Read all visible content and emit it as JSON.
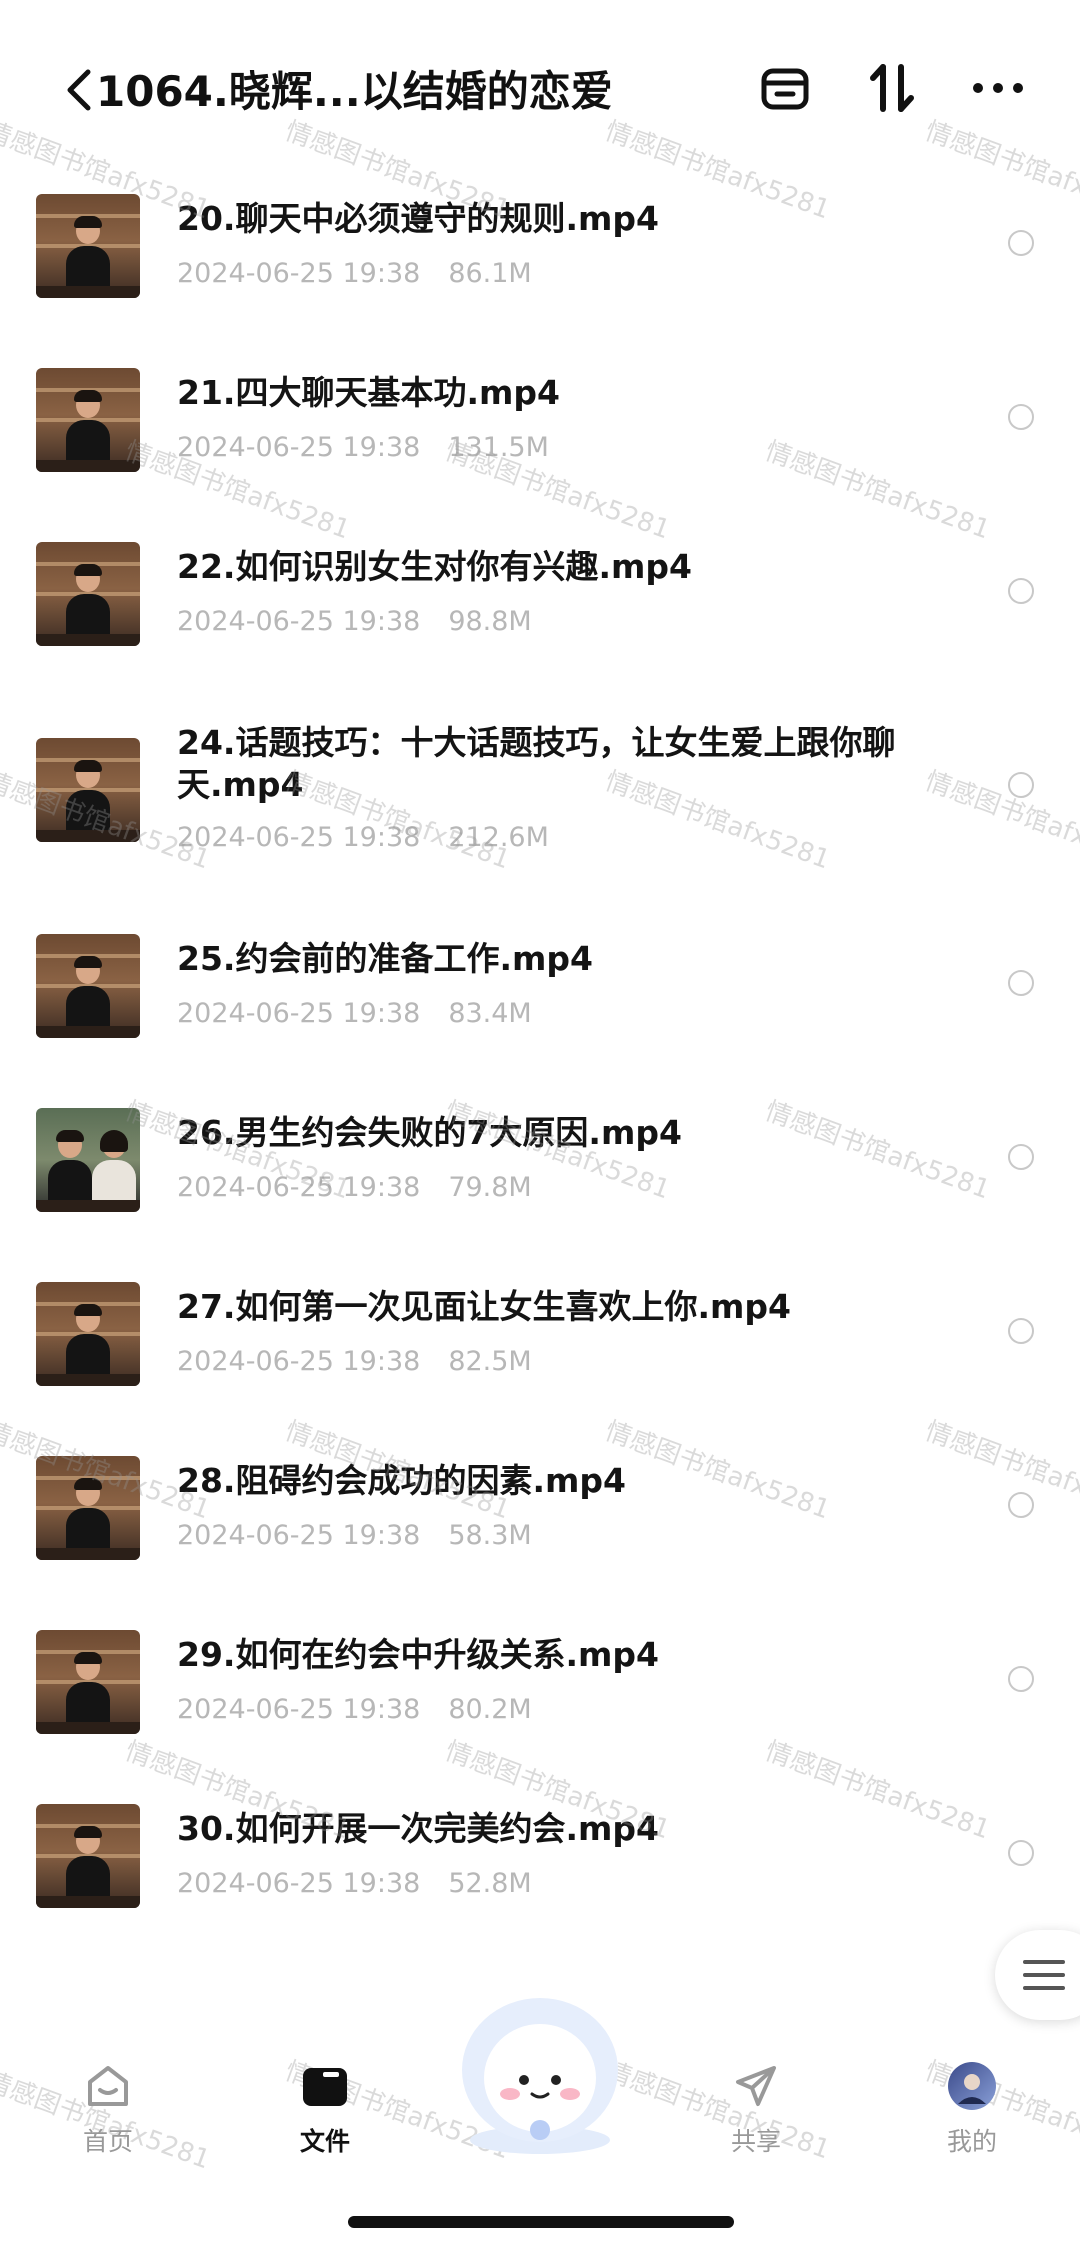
{
  "header": {
    "title": "1064.晓辉...以结婚的恋爱",
    "icons": [
      "back-icon",
      "tray-icon",
      "sort-icon",
      "more-icon"
    ]
  },
  "files": [
    {
      "name": "20.聊天中必须遵守的规则.mp4",
      "date": "2024-06-25 19:38",
      "size": "86.1M"
    },
    {
      "name": "21.四大聊天基本功.mp4",
      "date": "2024-06-25 19:38",
      "size": "131.5M"
    },
    {
      "name": "22.如何识别女生对你有兴趣.mp4",
      "date": "2024-06-25 19:38",
      "size": "98.8M"
    },
    {
      "name": "24.话题技巧：十大话题技巧，让女生爱上跟你聊天.mp4",
      "date": "2024-06-25 19:38",
      "size": "212.6M"
    },
    {
      "name": "25.约会前的准备工作.mp4",
      "date": "2024-06-25 19:38",
      "size": "83.4M"
    },
    {
      "name": "26.男生约会失败的7大原因.mp4",
      "date": "2024-06-25 19:38",
      "size": "79.8M"
    },
    {
      "name": "27.如何第一次见面让女生喜欢上你.mp4",
      "date": "2024-06-25 19:38",
      "size": "82.5M"
    },
    {
      "name": "28.阻碍约会成功的因素.mp4",
      "date": "2024-06-25 19:38",
      "size": "58.3M"
    },
    {
      "name": "29.如何在约会中升级关系.mp4",
      "date": "2024-06-25 19:38",
      "size": "80.2M"
    },
    {
      "name": "30.如何开展一次完美约会.mp4",
      "date": "2024-06-25 19:38",
      "size": "52.8M"
    }
  ],
  "watermark": "情感图书馆afx5281",
  "tabs": [
    {
      "label": "首页",
      "icon": "home-icon"
    },
    {
      "label": "文件",
      "icon": "folder-icon",
      "active": true
    },
    {
      "label": "共享",
      "icon": "send-icon"
    },
    {
      "label": "我的",
      "icon": "avatar-icon"
    }
  ],
  "colors": {
    "text": "#141414",
    "meta": "#b7b7b7",
    "active_tab": "#111111",
    "inactive_tab": "#999999"
  }
}
